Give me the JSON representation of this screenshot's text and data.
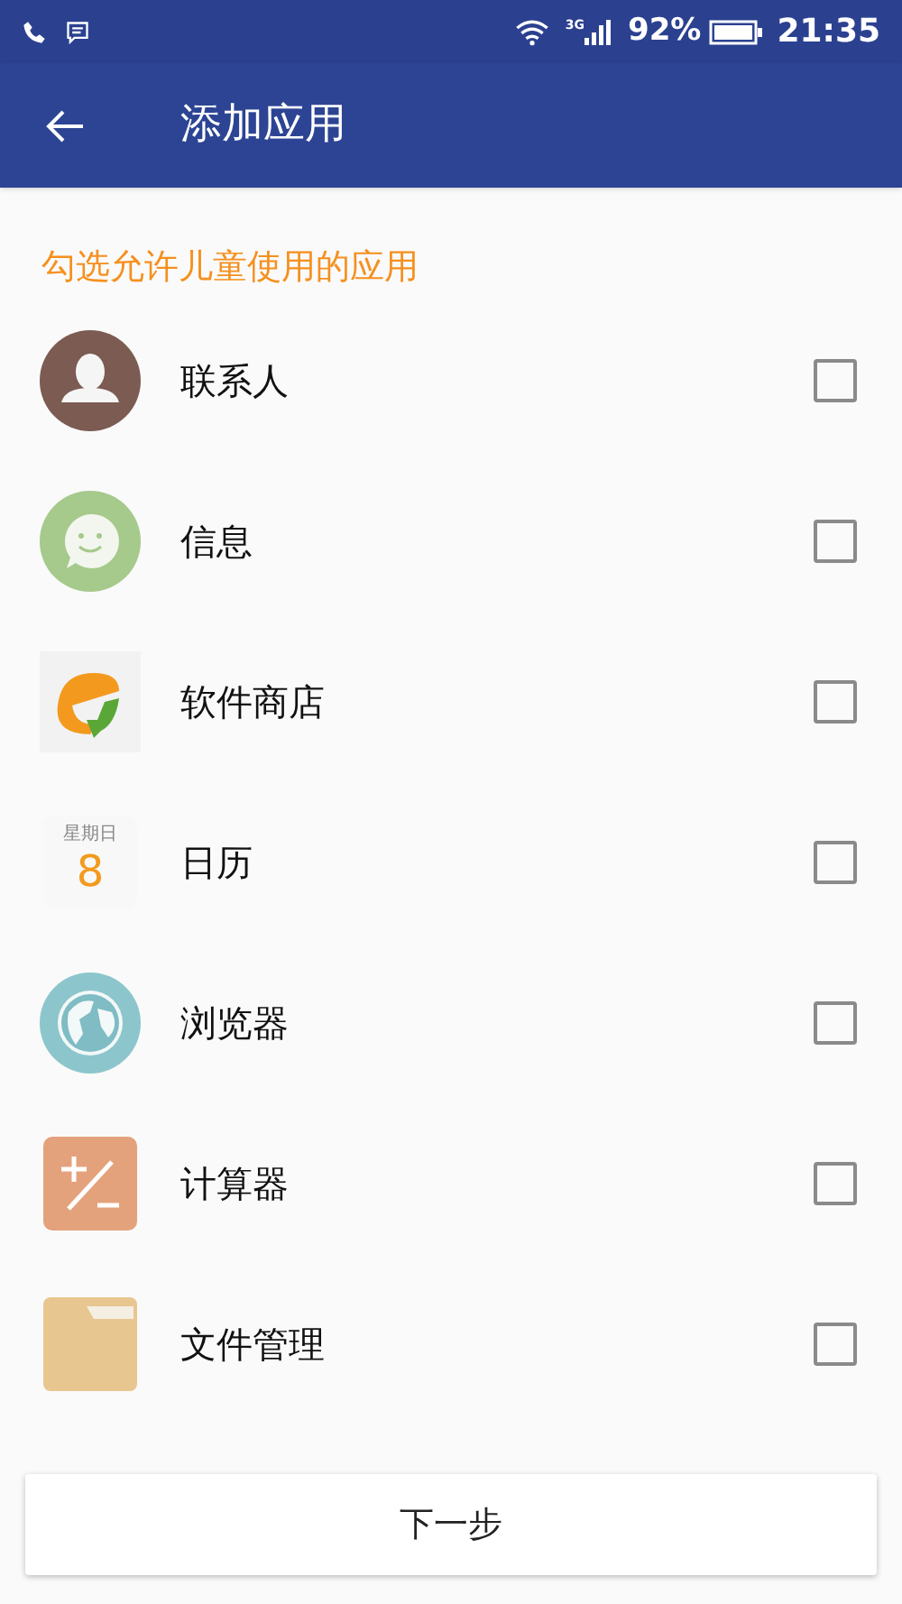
{
  "status_bar": {
    "battery": "92%",
    "network": "3G",
    "time": "21:35"
  },
  "app_bar": {
    "title": "添加应用"
  },
  "section_title": "勾选允许儿童使用的应用",
  "apps": [
    {
      "kind": "contacts",
      "name": "联系人",
      "checked": false
    },
    {
      "kind": "messages",
      "name": "信息",
      "checked": false
    },
    {
      "kind": "store",
      "name": "软件商店",
      "checked": false
    },
    {
      "kind": "calendar",
      "name": "日历",
      "checked": false,
      "icon_weekday": "星期日",
      "icon_day": "8"
    },
    {
      "kind": "browser",
      "name": "浏览器",
      "checked": false
    },
    {
      "kind": "calculator",
      "name": "计算器",
      "checked": false
    },
    {
      "kind": "files",
      "name": "文件管理",
      "checked": false
    }
  ],
  "next_button": "下一步"
}
